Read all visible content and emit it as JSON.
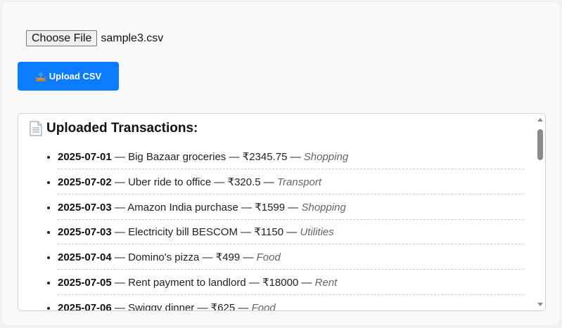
{
  "file_input": {
    "button_label": "Choose File",
    "file_name": "sample3.csv"
  },
  "upload_button": {
    "icon": "outbox-tray-icon",
    "label": "Upload CSV",
    "color": "#0b7cff"
  },
  "transactions_panel": {
    "icon": "document-icon",
    "title": "Uploaded Transactions:",
    "items": [
      {
        "date": "2025-07-01",
        "description": "Big Bazaar groceries",
        "amount": "₹2345.75",
        "category": "Shopping"
      },
      {
        "date": "2025-07-02",
        "description": "Uber ride to office",
        "amount": "₹320.5",
        "category": "Transport"
      },
      {
        "date": "2025-07-03",
        "description": "Amazon India purchase",
        "amount": "₹1599",
        "category": "Shopping"
      },
      {
        "date": "2025-07-03",
        "description": "Electricity bill BESCOM",
        "amount": "₹1150",
        "category": "Utilities"
      },
      {
        "date": "2025-07-04",
        "description": "Domino's pizza",
        "amount": "₹499",
        "category": "Food"
      },
      {
        "date": "2025-07-05",
        "description": "Rent payment to landlord",
        "amount": "₹18000",
        "category": "Rent"
      },
      {
        "date": "2025-07-06",
        "description": "Swiggy dinner",
        "amount": "₹625",
        "category": "Food"
      }
    ],
    "separator": " — "
  }
}
